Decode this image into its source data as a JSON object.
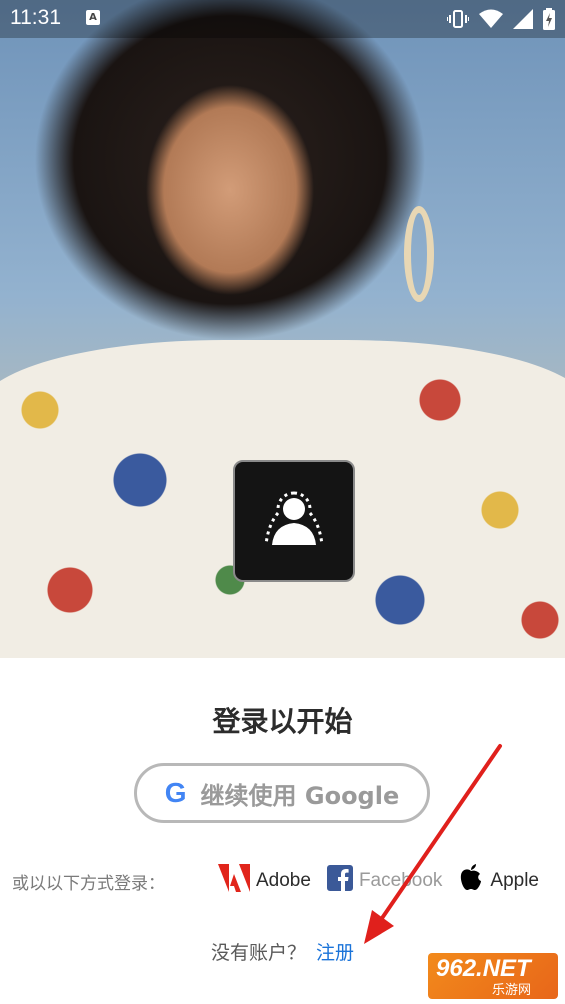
{
  "status_bar": {
    "time": "11:31",
    "notification_icon": "A",
    "icons": [
      "vibrate-icon",
      "wifi-icon",
      "signal-icon",
      "battery-charging-icon"
    ]
  },
  "hero": {
    "description_icon": "portrait-selection-icon"
  },
  "login": {
    "title": "登录以开始",
    "google_button_label": "继续使用 Google",
    "alt_label": "或以以下方式登录：",
    "providers": [
      {
        "name": "Adobe",
        "icon": "adobe-icon",
        "color": "#e1251b"
      },
      {
        "name": "Facebook",
        "icon": "facebook-icon",
        "color": "#3b5998"
      },
      {
        "name": "Apple",
        "icon": "apple-icon",
        "color": "#000000"
      }
    ],
    "no_account_text": "没有账户？",
    "signup_link": "注册"
  },
  "colors": {
    "link": "#1a73d9",
    "annotation_arrow": "#e0201c",
    "google_border": "#b8b8b8"
  },
  "watermark": {
    "brand": "962.NET",
    "tagline": "乐游网"
  }
}
